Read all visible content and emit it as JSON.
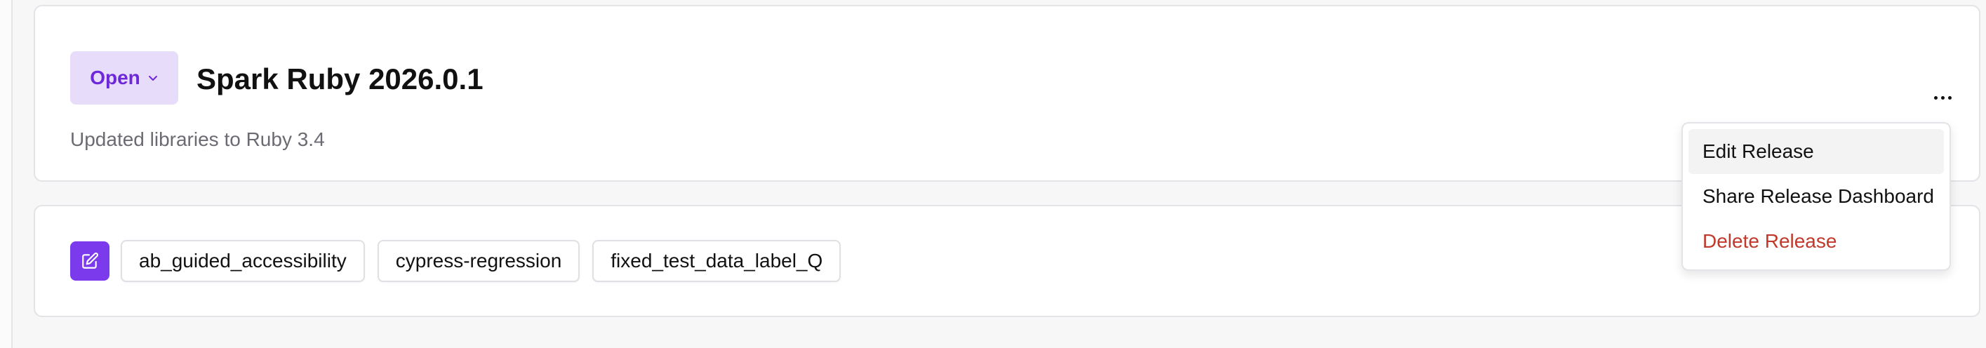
{
  "release": {
    "status_label": "Open",
    "title": "Spark Ruby 2026.0.1",
    "description": "Updated libraries to Ruby 3.4"
  },
  "actions_menu": {
    "items": [
      {
        "label": "Edit Release"
      },
      {
        "label": "Share Release Dashboard"
      },
      {
        "label": "Delete Release"
      }
    ]
  },
  "tags": {
    "items": [
      {
        "label": "ab_guided_accessibility"
      },
      {
        "label": "cypress-regression"
      },
      {
        "label": "fixed_test_data_label_Q"
      }
    ]
  },
  "colors": {
    "accent": "#7c3aed",
    "status_bg": "#e8dcfb",
    "danger": "#c0392b"
  },
  "icons": {
    "status_chevron": "chevron-down-icon",
    "more": "more-horizontal-icon",
    "edit_tags": "edit-icon"
  }
}
